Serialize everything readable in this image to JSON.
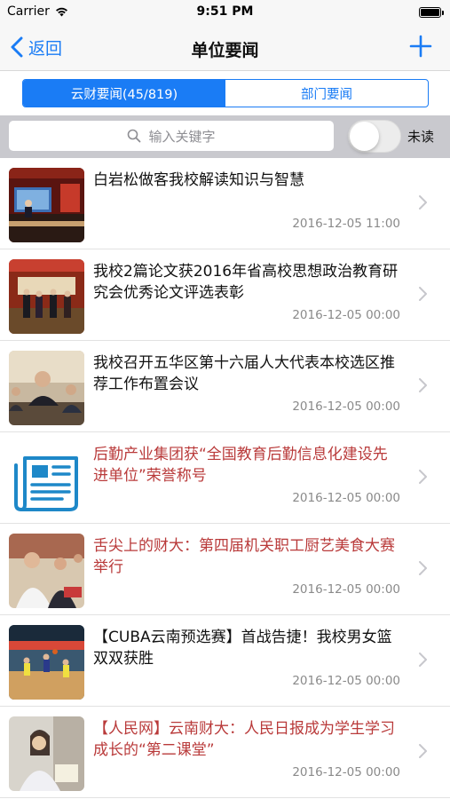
{
  "status_bar": {
    "carrier": "Carrier",
    "time": "9:51 PM",
    "battery_level": 1.0
  },
  "nav": {
    "back_label": "返回",
    "title": "单位要闻",
    "add_icon": "plus-icon",
    "back_icon": "chevron-left-icon"
  },
  "segments": [
    {
      "label": "云财要闻(45/819)",
      "active": true
    },
    {
      "label": "部门要闻",
      "active": false
    }
  ],
  "search": {
    "placeholder": "输入关键字",
    "toggle_label": "未读",
    "toggle_on": false
  },
  "colors": {
    "accent": "#1a7cf5",
    "unread_title": "#b93a3a",
    "read_title": "#111111",
    "date": "#8a8a8a"
  },
  "news": [
    {
      "title": "白岩松做客我校解读知识与智慧",
      "date": "2016-12-05 11:00",
      "read": true,
      "thumb": "conference-stage-photo"
    },
    {
      "title": "我校2篇论文获2016年省高校思想政治教育研究会优秀论文评选表彰",
      "date": "2016-12-05 00:00",
      "read": true,
      "thumb": "award-ceremony-photo"
    },
    {
      "title": "我校召开五华区第十六届人大代表本校选区推荐工作布置会议",
      "date": "2016-12-05 00:00",
      "read": true,
      "thumb": "meeting-photo"
    },
    {
      "title": "后勤产业集团获“全国教育后勤信息化建设先进单位”荣誉称号",
      "date": "2016-12-05 00:00",
      "read": false,
      "thumb": "newspaper-icon"
    },
    {
      "title": "舌尖上的财大：第四届机关职工厨艺美食大赛举行",
      "date": "2016-12-05 00:00",
      "read": false,
      "thumb": "cooking-contest-photo"
    },
    {
      "title": "【CUBA云南预选赛】首战告捷！我校男女篮双双获胜",
      "date": "2016-12-05 00:00",
      "read": true,
      "thumb": "basketball-photo"
    },
    {
      "title": "【人民网】云南财大：人民日报成为学生学习成长的“第二课堂”",
      "date": "2016-12-05 00:00",
      "read": false,
      "thumb": "student-reading-photo"
    }
  ]
}
